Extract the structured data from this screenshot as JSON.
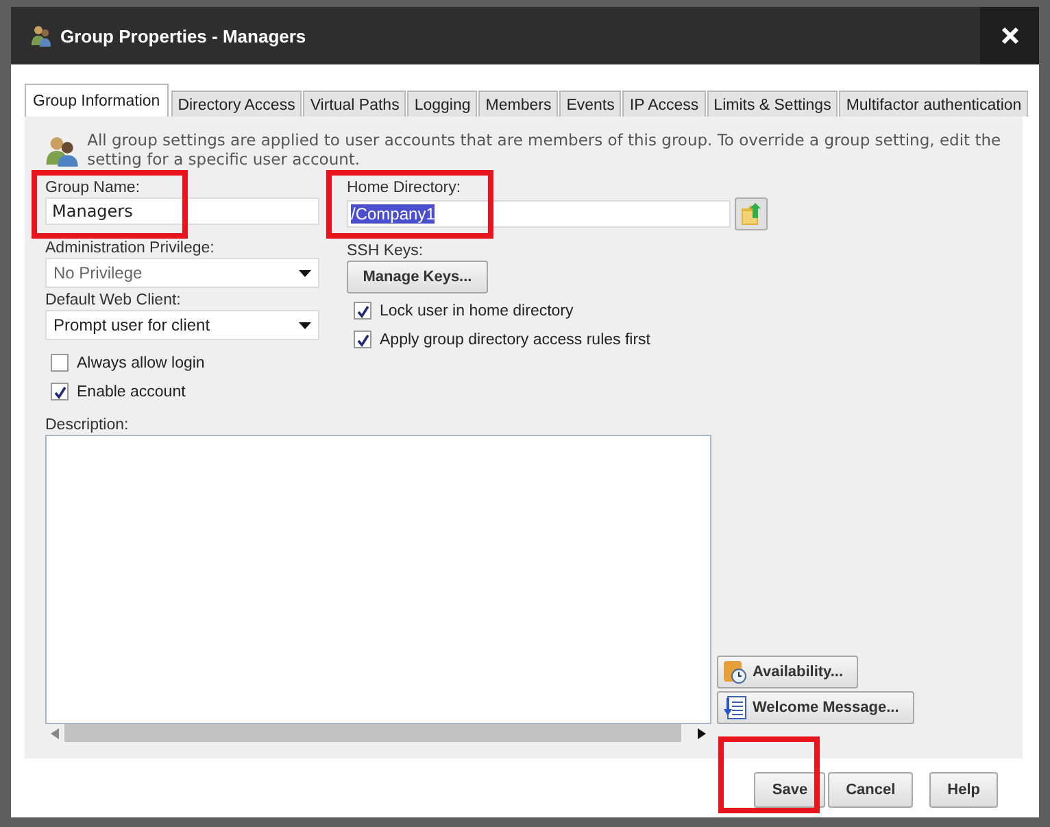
{
  "window": {
    "title": "Group Properties - Managers"
  },
  "tabs": [
    {
      "label": "Group Information",
      "selected": true
    },
    {
      "label": "Directory Access",
      "selected": false
    },
    {
      "label": "Virtual Paths",
      "selected": false
    },
    {
      "label": "Logging",
      "selected": false
    },
    {
      "label": "Members",
      "selected": false
    },
    {
      "label": "Events",
      "selected": false
    },
    {
      "label": "IP Access",
      "selected": false
    },
    {
      "label": "Limits & Settings",
      "selected": false
    },
    {
      "label": "Multifactor authentication",
      "selected": false
    }
  ],
  "info": "All group settings are applied to user accounts that are members of this group. To override a group setting, edit the setting for a specific user account.",
  "group_name": {
    "label": "Group Name:",
    "value": "Managers",
    "highlighted": true
  },
  "administration_privilege": {
    "label": "Administration Privilege:",
    "value": "No Privilege"
  },
  "default_web_client": {
    "label": "Default Web Client:",
    "value": "Prompt user for client"
  },
  "left_checkboxes": [
    {
      "label": "Always allow login",
      "checked": false
    },
    {
      "label": "Enable account",
      "checked": true
    }
  ],
  "home_directory": {
    "label": "Home Directory:",
    "value": "/Company1",
    "text_selected": true,
    "highlighted": true
  },
  "ssh_keys": {
    "label": "SSH Keys:",
    "button": "Manage Keys..."
  },
  "right_checkboxes": [
    {
      "label": "Lock user in home directory",
      "checked": true
    },
    {
      "label": "Apply group directory access rules first",
      "checked": true
    }
  ],
  "description": {
    "label": "Description:"
  },
  "side_buttons": [
    {
      "label": "Availability...",
      "kind": "clock"
    },
    {
      "label": "Welcome Message...",
      "kind": "document"
    }
  ],
  "footer_buttons": [
    {
      "label": "Save",
      "highlighted": true
    },
    {
      "label": "Cancel",
      "highlighted": false
    },
    {
      "label": "Help",
      "highlighted": false
    }
  ]
}
